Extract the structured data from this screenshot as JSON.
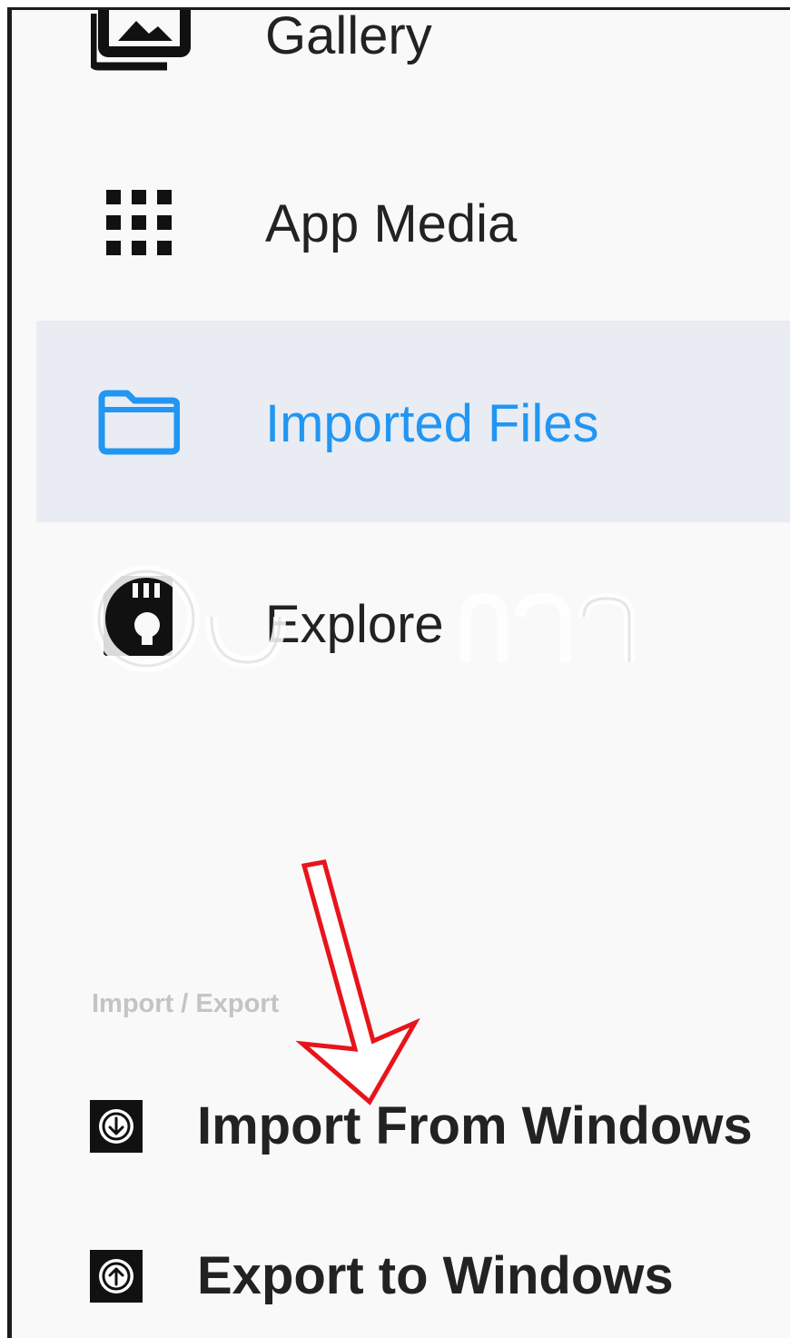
{
  "drawer": {
    "items": [
      {
        "label": "Gallery",
        "icon": "gallery-icon",
        "selected": false
      },
      {
        "label": "App Media",
        "icon": "grid-icon",
        "selected": false
      },
      {
        "label": "Imported Files",
        "icon": "folder-icon",
        "selected": true
      },
      {
        "label": "Explore",
        "icon": "sd-card-icon",
        "selected": false
      }
    ],
    "section_header": "Import / Export",
    "actions": [
      {
        "label": "Import From Windows",
        "icon": "import-download-icon"
      },
      {
        "label": "Export to Windows",
        "icon": "export-upload-icon"
      }
    ]
  },
  "colors": {
    "accent": "#2196f3",
    "selected_background": "#e9ecf3",
    "text": "#222222",
    "section_header": "#c4c4c4",
    "annotation_arrow": "#e8141b"
  }
}
